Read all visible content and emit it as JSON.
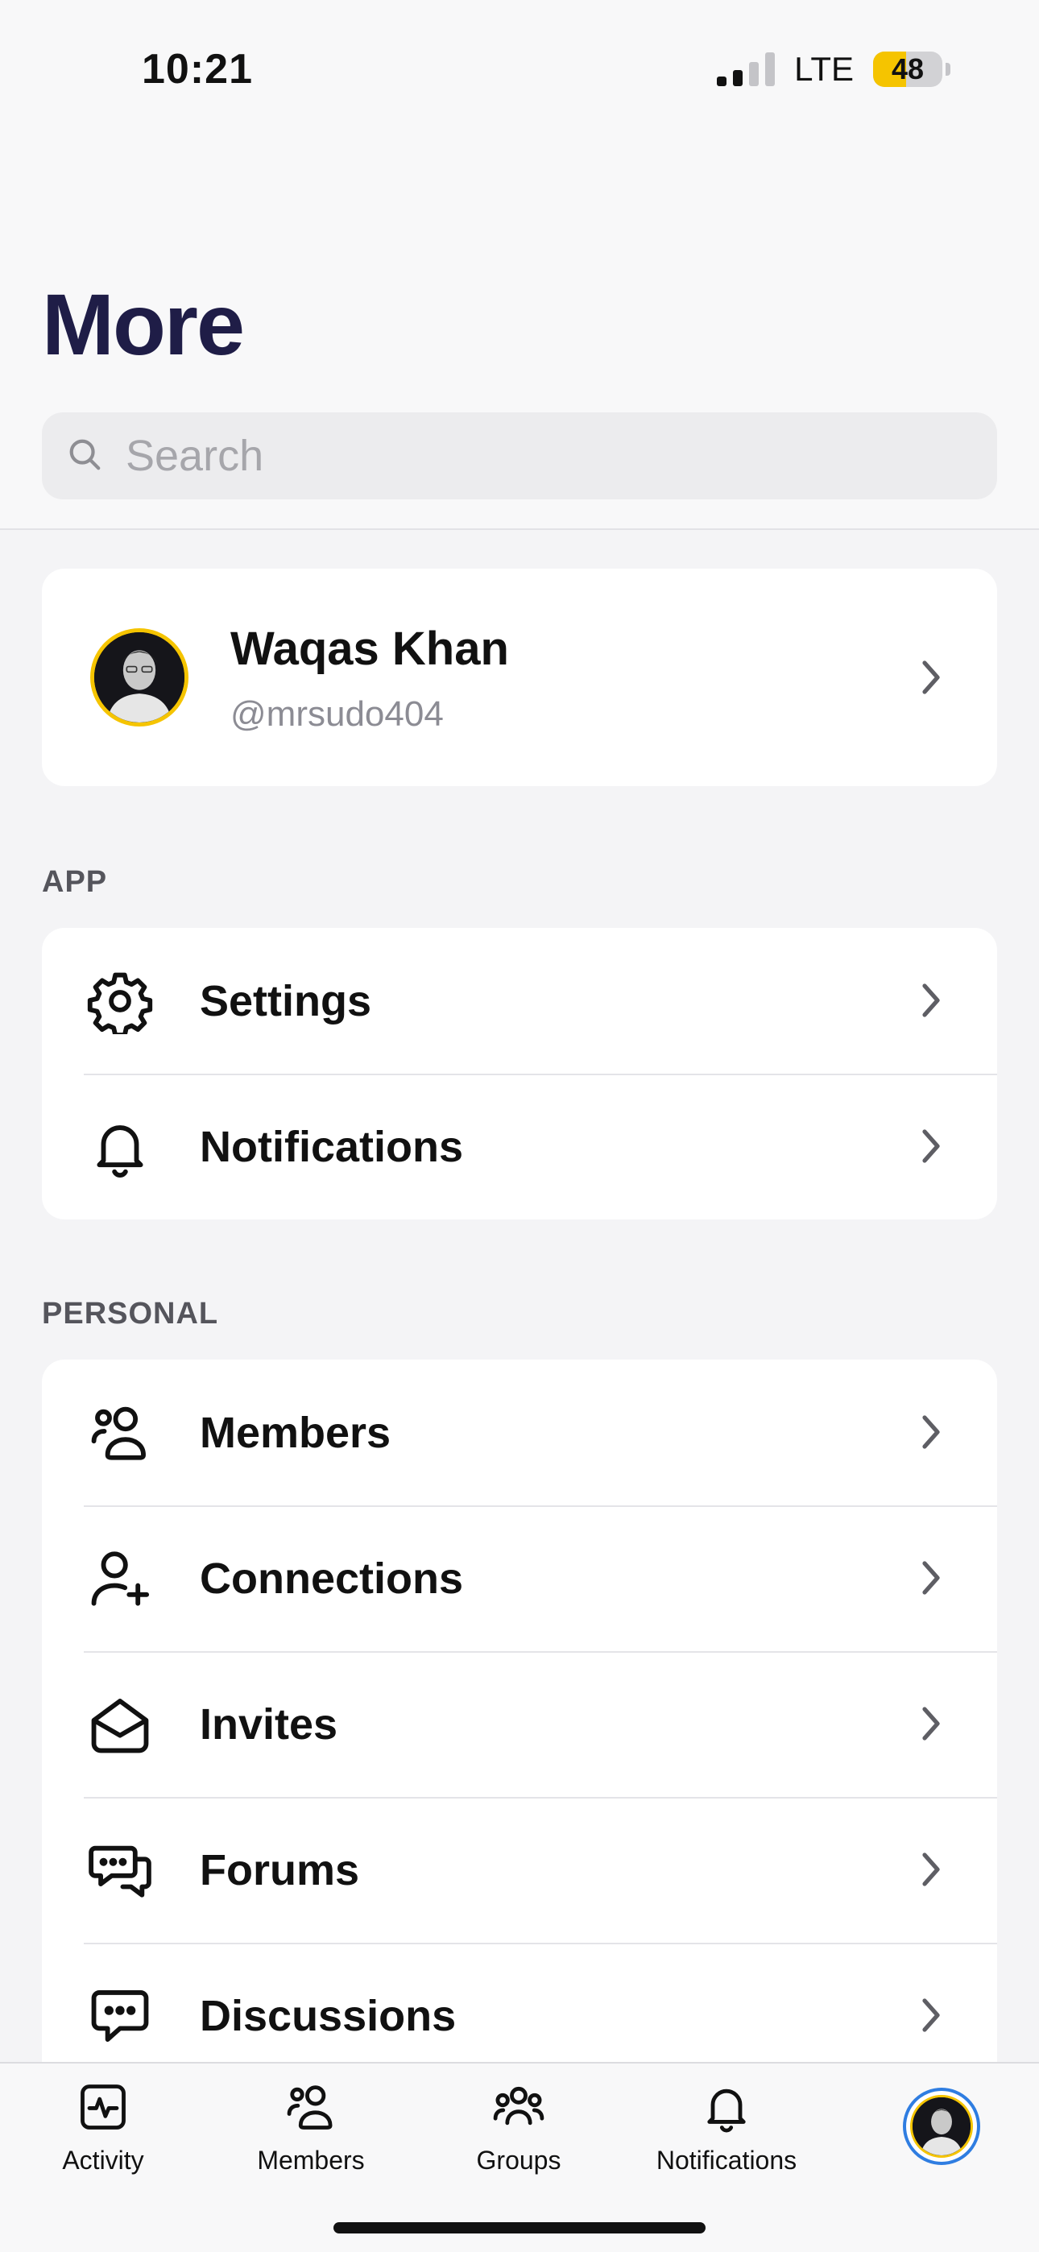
{
  "status": {
    "time": "10:21",
    "network": "LTE",
    "battery": "48",
    "battery_level": 0.48
  },
  "header": {
    "title": "More"
  },
  "search": {
    "placeholder": "Search"
  },
  "profile": {
    "name": "Waqas Khan",
    "handle": "@mrsudo404"
  },
  "sections": {
    "app": {
      "label": "APP",
      "items": [
        {
          "label": "Settings",
          "icon": "gear-icon"
        },
        {
          "label": "Notifications",
          "icon": "bell-icon"
        }
      ]
    },
    "personal": {
      "label": "PERSONAL",
      "items": [
        {
          "label": "Members",
          "icon": "users-icon"
        },
        {
          "label": "Connections",
          "icon": "user-plus-icon"
        },
        {
          "label": "Invites",
          "icon": "envelope-open-icon"
        },
        {
          "label": "Forums",
          "icon": "chat-bubbles-icon"
        },
        {
          "label": "Discussions",
          "icon": "chat-bubble-icon"
        }
      ]
    }
  },
  "tabbar": {
    "items": [
      {
        "label": "Activity",
        "icon": "activity-icon"
      },
      {
        "label": "Members",
        "icon": "users-icon"
      },
      {
        "label": "Groups",
        "icon": "group-icon"
      },
      {
        "label": "Notifications",
        "icon": "bell-icon"
      }
    ],
    "profile_icon": "avatar",
    "active_color": "#2f7de1"
  },
  "colors": {
    "title": "#1f1d47",
    "avatar_ring": "#f5c400",
    "battery": "#f5c400"
  }
}
